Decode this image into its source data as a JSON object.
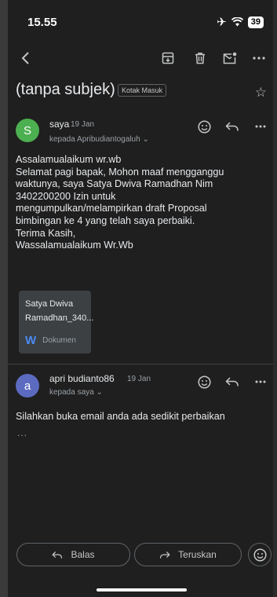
{
  "status_bar": {
    "time": "15.55",
    "battery": "39"
  },
  "email": {
    "subject": "(tanpa subjek)",
    "label_chip": "Kotak Masuk"
  },
  "messages": [
    {
      "avatar_letter": "S",
      "avatar_color": "#4caf50",
      "sender": "saya",
      "date": "19 Jan",
      "recipient": "kepada Apribudiantogaluh",
      "body_lines": [
        "Assalamualaikum wr.wb",
        "Selamat pagi bapak, Mohon maaf mengganggu",
        "waktunya, saya Satya Dwiva Ramadhan Nim",
        "3402200200 Izin untuk",
        "mengumpulkan/melampirkan draft Proposal",
        "bimbingan ke 4 yang telah saya perbaiki.",
        "Terima Kasih,",
        "Wassalamualaikum Wr.Wb"
      ],
      "attachment": {
        "name_line1": "Satya Dwiva",
        "name_line2": "Ramadhan_340...",
        "type_icon_letter": "W",
        "type_label": "Dokumen"
      }
    },
    {
      "avatar_letter": "a",
      "avatar_color": "#5c6bc0",
      "sender": "apri budianto86",
      "date": "19 Jan",
      "recipient": "kepada saya",
      "body": "Silahkan buka email anda ada sedikit perbaikan",
      "more_indicator": "..."
    }
  ],
  "actions": {
    "reply_label": "Balas",
    "forward_label": "Teruskan"
  },
  "colors": {
    "background": "#1f1f1f",
    "text": "#e8eaed",
    "muted": "#9aa0a6"
  }
}
